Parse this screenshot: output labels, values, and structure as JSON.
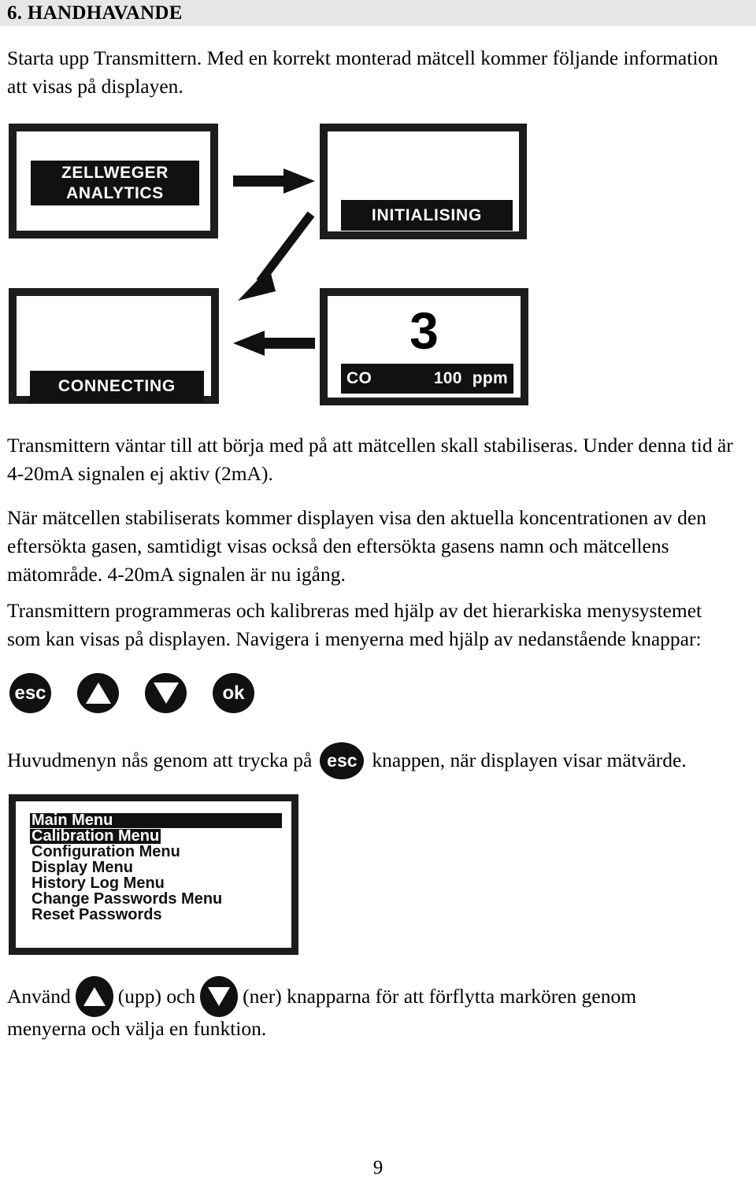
{
  "header": {
    "title": "6. HANDHAVANDE"
  },
  "paragraphs": {
    "intro": "Starta upp Transmittern. Med en korrekt monterad mätcell kommer följande information att visas på displayen.",
    "waiting": "Transmittern väntar till att börja med på att mätcellen skall stabiliseras. Under denna tid är 4-20mA signalen ej aktiv (2mA).",
    "stabilised": "När mätcellen stabiliserats kommer displayen visa den aktuella koncentrationen av den eftersökta gasen, samtidigt visas också den eftersökta gasens namn och mätcellens mätområde. 4-20mA signalen är nu igång.",
    "programming": "Transmittern programmeras och kalibreras med hjälp av det hierarkiska menysystemet som kan visas på displayen. Navigera i menyerna med hjälp av nedanstående knappar:"
  },
  "startup_sequence": {
    "panel1": {
      "line1": "ZELLWEGER",
      "line2": "ANALYTICS"
    },
    "panel2": {
      "status": "INITIALISING"
    },
    "panel3": {
      "status": "CONNECTING"
    },
    "panel4": {
      "value": "3",
      "gas": "CO",
      "range": "100",
      "unit": "ppm"
    },
    "arrows": [
      {
        "name": "arrow-right",
        "direction": "right"
      },
      {
        "name": "arrow-diagonal-down-left",
        "direction": "down-left"
      },
      {
        "name": "arrow-left",
        "direction": "left"
      }
    ]
  },
  "keypad": {
    "esc": "esc",
    "up": "",
    "down": "",
    "ok": "ok"
  },
  "mainmenu_access": {
    "before": "Huvudmenyn nås genom att trycka på",
    "key": "esc",
    "after": "knappen, när displayen visar mätvärde."
  },
  "menu_screen": {
    "items": [
      {
        "label": "Main Menu",
        "highlight": "full"
      },
      {
        "label": "Calibration Menu",
        "highlight": "text"
      },
      {
        "label": "Configuration Menu",
        "highlight": "none"
      },
      {
        "label": "Display Menu",
        "highlight": "none"
      },
      {
        "label": "History Log Menu",
        "highlight": "none"
      },
      {
        "label": "Change Passwords Menu",
        "highlight": "none"
      },
      {
        "label": "Reset Passwords",
        "highlight": "none"
      }
    ]
  },
  "navigation_note": {
    "part1": "Använd",
    "up_label": "(upp) och",
    "down_label": "(ner) knapparna för att förflytta markören genom",
    "part2": "menyerna och välja en funktion."
  },
  "footer": {
    "page_number": "9"
  },
  "colors": {
    "header_band": "#e6e6e6",
    "ink": "#000000",
    "lcd_frame": "#1c1c1c",
    "lcd_highlight": "#111111",
    "paper": "#ffffff"
  }
}
